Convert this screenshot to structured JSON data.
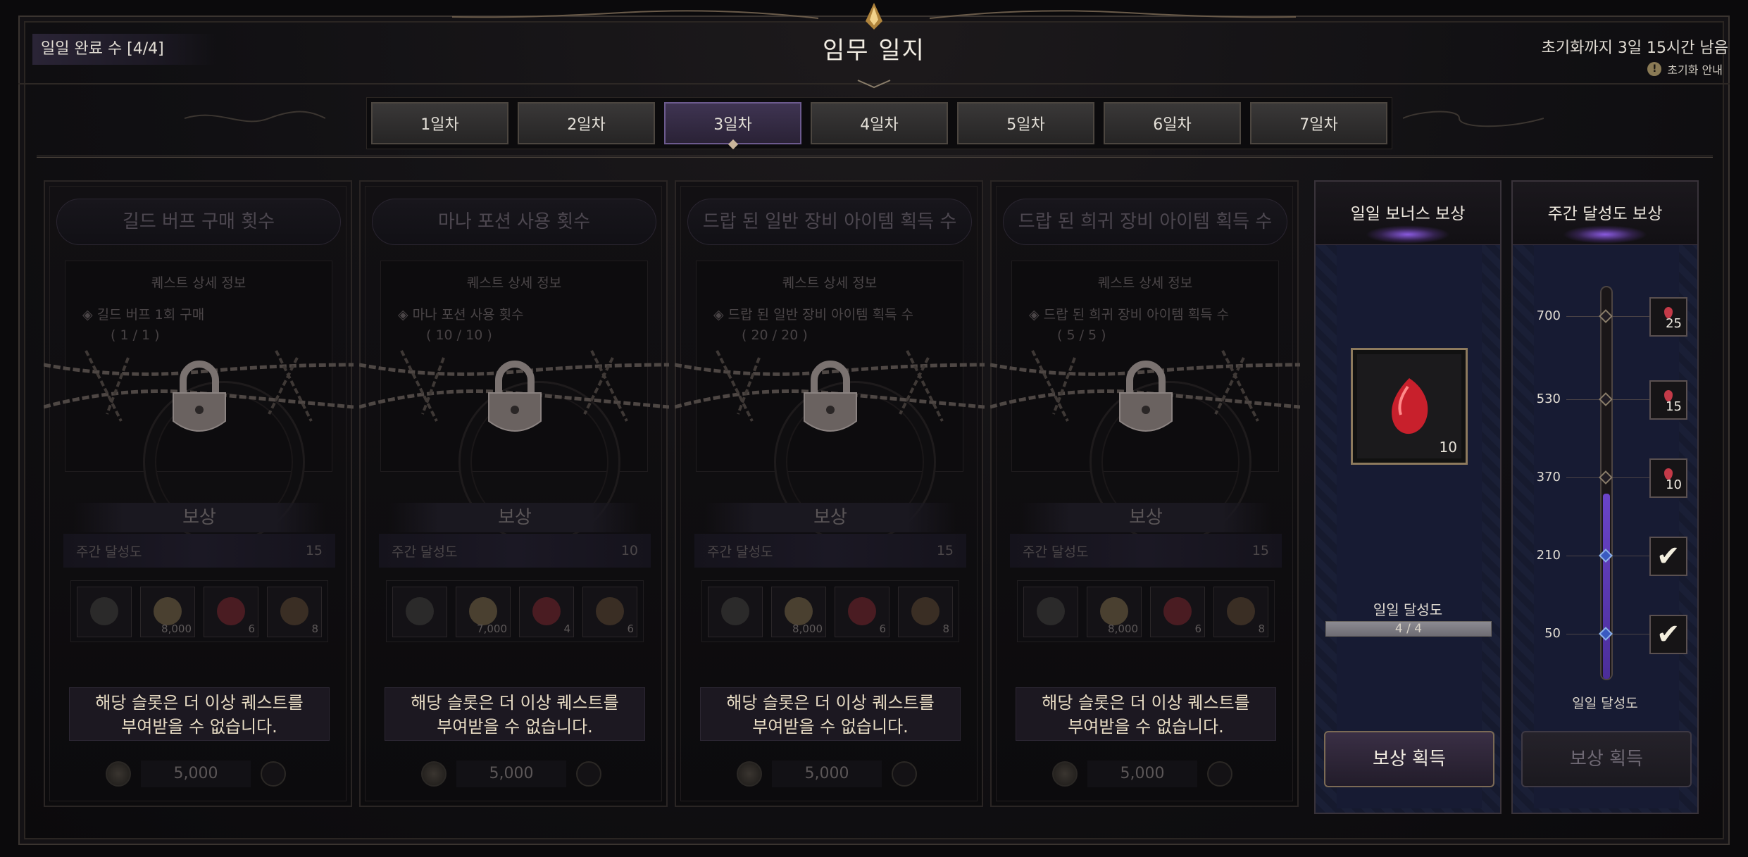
{
  "header": {
    "daily_count": "일일 완료 수 [4/4]",
    "title": "임무 일지",
    "reset_text": "초기화까지 3일 15시간 남음",
    "reset_info": "초기화 안내"
  },
  "tabs": [
    {
      "label": "1일차",
      "active": false
    },
    {
      "label": "2일차",
      "active": false
    },
    {
      "label": "3일차",
      "active": true
    },
    {
      "label": "4일차",
      "active": false
    },
    {
      "label": "5일차",
      "active": false
    },
    {
      "label": "6일차",
      "active": false
    },
    {
      "label": "7일차",
      "active": false
    }
  ],
  "quests": [
    {
      "title": "길드 버프 구매 횟수",
      "detail_head": "퀘스트 상세 정보",
      "detail_line": "길드 버프 1회 구매",
      "detail_progress": "( 1 / 1 )",
      "reward_label": "보상",
      "weekly_label": "주간 달성도",
      "weekly_value": "15",
      "items": [
        {
          "icon": "exp-icon",
          "qty": ""
        },
        {
          "icon": "gold-coin-icon",
          "qty": "8,000"
        },
        {
          "icon": "red-gem-icon",
          "qty": "6"
        },
        {
          "icon": "feather-icon",
          "qty": "8"
        }
      ],
      "notice": [
        "해당 슬롯은 더 이상 퀘스트를",
        "부여받을 수 없습니다."
      ],
      "cost": "5,000"
    },
    {
      "title": "마나 포션 사용 횟수",
      "detail_head": "퀘스트 상세 정보",
      "detail_line": "마나 포션 사용 횟수",
      "detail_progress": "( 10 / 10 )",
      "reward_label": "보상",
      "weekly_label": "주간 달성도",
      "weekly_value": "10",
      "items": [
        {
          "icon": "exp-icon",
          "qty": ""
        },
        {
          "icon": "gold-coin-icon",
          "qty": "7,000"
        },
        {
          "icon": "red-gem-icon",
          "qty": "4"
        },
        {
          "icon": "feather-icon",
          "qty": "6"
        }
      ],
      "notice": [
        "해당 슬롯은 더 이상 퀘스트를",
        "부여받을 수 없습니다."
      ],
      "cost": "5,000"
    },
    {
      "title": "드랍 된 일반 장비 아이템 획득 수",
      "detail_head": "퀘스트 상세 정보",
      "detail_line": "드랍 된 일반 장비 아이템 획득 수",
      "detail_progress": "( 20 / 20 )",
      "reward_label": "보상",
      "weekly_label": "주간 달성도",
      "weekly_value": "15",
      "items": [
        {
          "icon": "exp-icon",
          "qty": ""
        },
        {
          "icon": "gold-coin-icon",
          "qty": "8,000"
        },
        {
          "icon": "red-gem-icon",
          "qty": "6"
        },
        {
          "icon": "feather-icon",
          "qty": "8"
        }
      ],
      "notice": [
        "해당 슬롯은 더 이상 퀘스트를",
        "부여받을 수 없습니다."
      ],
      "cost": "5,000"
    },
    {
      "title": "드랍 된 희귀 장비 아이템 획득 수",
      "detail_head": "퀘스트 상세 정보",
      "detail_line": "드랍 된 희귀 장비 아이템 획득 수",
      "detail_progress": "( 5 / 5 )",
      "reward_label": "보상",
      "weekly_label": "주간 달성도",
      "weekly_value": "15",
      "items": [
        {
          "icon": "exp-icon",
          "qty": ""
        },
        {
          "icon": "gold-coin-icon",
          "qty": "8,000"
        },
        {
          "icon": "red-gem-icon",
          "qty": "6"
        },
        {
          "icon": "feather-icon",
          "qty": "8"
        }
      ],
      "notice": [
        "해당 슬롯은 더 이상 퀘스트를",
        "부여받을 수 없습니다."
      ],
      "cost": "5,000"
    }
  ],
  "daily_bonus": {
    "title": "일일 보너스 보상",
    "item_qty": "10",
    "progress_label": "일일 달성도",
    "progress_text": "4 / 4",
    "progress_fraction": 1.0,
    "claim_label": "보상 획득"
  },
  "weekly_reward": {
    "title": "주간 달성도 보상",
    "progress_value": 370,
    "max_value": 700,
    "milestones": [
      {
        "value": "700",
        "qty": "25",
        "claimed": false
      },
      {
        "value": "530",
        "qty": "15",
        "claimed": false
      },
      {
        "value": "370",
        "qty": "10",
        "claimed": false
      },
      {
        "value": "210",
        "qty": "",
        "claimed": true
      },
      {
        "value": "50",
        "qty": "",
        "claimed": true
      }
    ],
    "progress_label": "일일 달성도",
    "claim_label": "보상 획득"
  },
  "colors": {
    "accent_purple": "#6c5a8e",
    "gold_border": "#8d7a5d",
    "gem_red": "#c43a48"
  }
}
